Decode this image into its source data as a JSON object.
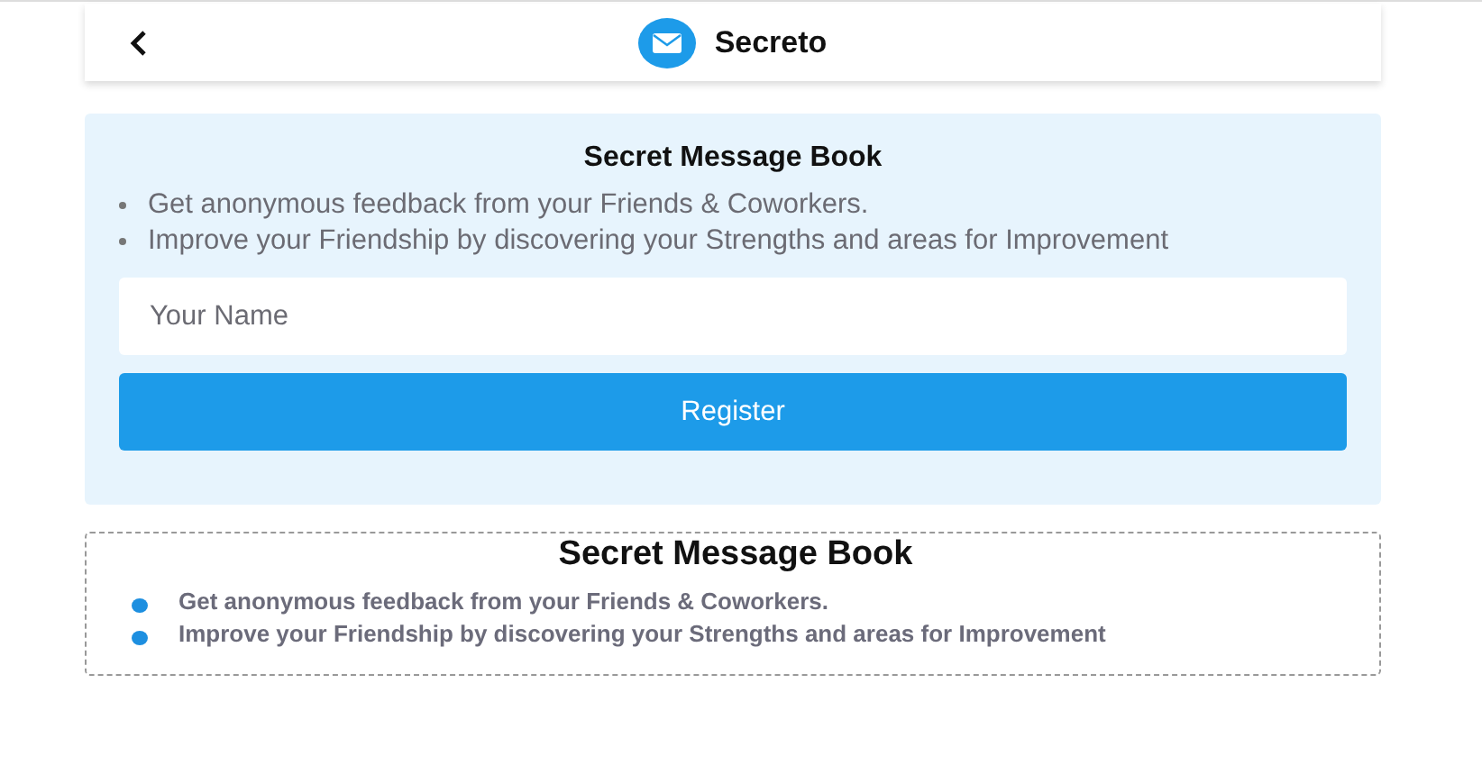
{
  "header": {
    "title": "Secreto"
  },
  "intro_card": {
    "title": "Secret Message Book",
    "bullets": [
      "Get anonymous feedback from your Friends & Coworkers.",
      "Improve your Friendship by discovering your Strengths and areas for Improvement"
    ],
    "name_field": {
      "placeholder": "Your Name"
    },
    "button": "Register"
  },
  "info_card": {
    "title": "Secret Message Book",
    "bullets": [
      "Get anonymous feedback from your Friends & Coworkers.",
      "Improve your Friendship by discovering your Strengths and areas for Improvement"
    ]
  }
}
